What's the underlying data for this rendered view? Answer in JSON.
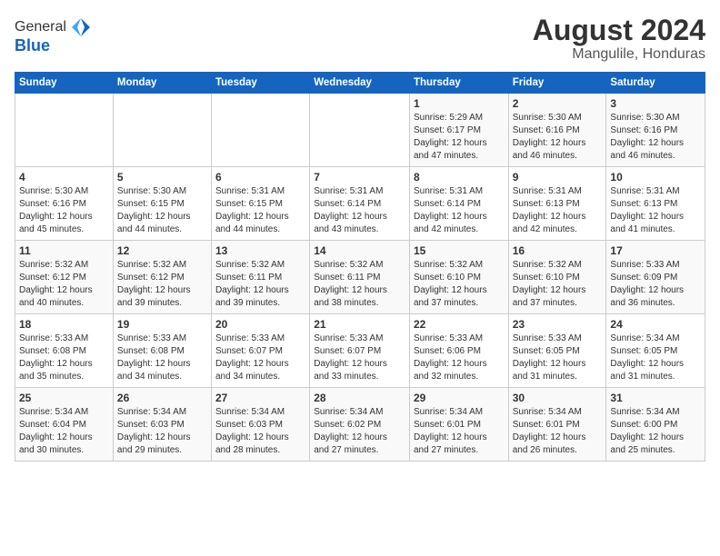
{
  "header": {
    "logo_general": "General",
    "logo_blue": "Blue",
    "title": "August 2024",
    "subtitle": "Mangulile, Honduras"
  },
  "calendar": {
    "days_of_week": [
      "Sunday",
      "Monday",
      "Tuesday",
      "Wednesday",
      "Thursday",
      "Friday",
      "Saturday"
    ],
    "weeks": [
      [
        {
          "day": "",
          "detail": ""
        },
        {
          "day": "",
          "detail": ""
        },
        {
          "day": "",
          "detail": ""
        },
        {
          "day": "",
          "detail": ""
        },
        {
          "day": "1",
          "detail": "Sunrise: 5:29 AM\nSunset: 6:17 PM\nDaylight: 12 hours\nand 47 minutes."
        },
        {
          "day": "2",
          "detail": "Sunrise: 5:30 AM\nSunset: 6:16 PM\nDaylight: 12 hours\nand 46 minutes."
        },
        {
          "day": "3",
          "detail": "Sunrise: 5:30 AM\nSunset: 6:16 PM\nDaylight: 12 hours\nand 46 minutes."
        }
      ],
      [
        {
          "day": "4",
          "detail": "Sunrise: 5:30 AM\nSunset: 6:16 PM\nDaylight: 12 hours\nand 45 minutes."
        },
        {
          "day": "5",
          "detail": "Sunrise: 5:30 AM\nSunset: 6:15 PM\nDaylight: 12 hours\nand 44 minutes."
        },
        {
          "day": "6",
          "detail": "Sunrise: 5:31 AM\nSunset: 6:15 PM\nDaylight: 12 hours\nand 44 minutes."
        },
        {
          "day": "7",
          "detail": "Sunrise: 5:31 AM\nSunset: 6:14 PM\nDaylight: 12 hours\nand 43 minutes."
        },
        {
          "day": "8",
          "detail": "Sunrise: 5:31 AM\nSunset: 6:14 PM\nDaylight: 12 hours\nand 42 minutes."
        },
        {
          "day": "9",
          "detail": "Sunrise: 5:31 AM\nSunset: 6:13 PM\nDaylight: 12 hours\nand 42 minutes."
        },
        {
          "day": "10",
          "detail": "Sunrise: 5:31 AM\nSunset: 6:13 PM\nDaylight: 12 hours\nand 41 minutes."
        }
      ],
      [
        {
          "day": "11",
          "detail": "Sunrise: 5:32 AM\nSunset: 6:12 PM\nDaylight: 12 hours\nand 40 minutes."
        },
        {
          "day": "12",
          "detail": "Sunrise: 5:32 AM\nSunset: 6:12 PM\nDaylight: 12 hours\nand 39 minutes."
        },
        {
          "day": "13",
          "detail": "Sunrise: 5:32 AM\nSunset: 6:11 PM\nDaylight: 12 hours\nand 39 minutes."
        },
        {
          "day": "14",
          "detail": "Sunrise: 5:32 AM\nSunset: 6:11 PM\nDaylight: 12 hours\nand 38 minutes."
        },
        {
          "day": "15",
          "detail": "Sunrise: 5:32 AM\nSunset: 6:10 PM\nDaylight: 12 hours\nand 37 minutes."
        },
        {
          "day": "16",
          "detail": "Sunrise: 5:32 AM\nSunset: 6:10 PM\nDaylight: 12 hours\nand 37 minutes."
        },
        {
          "day": "17",
          "detail": "Sunrise: 5:33 AM\nSunset: 6:09 PM\nDaylight: 12 hours\nand 36 minutes."
        }
      ],
      [
        {
          "day": "18",
          "detail": "Sunrise: 5:33 AM\nSunset: 6:08 PM\nDaylight: 12 hours\nand 35 minutes."
        },
        {
          "day": "19",
          "detail": "Sunrise: 5:33 AM\nSunset: 6:08 PM\nDaylight: 12 hours\nand 34 minutes."
        },
        {
          "day": "20",
          "detail": "Sunrise: 5:33 AM\nSunset: 6:07 PM\nDaylight: 12 hours\nand 34 minutes."
        },
        {
          "day": "21",
          "detail": "Sunrise: 5:33 AM\nSunset: 6:07 PM\nDaylight: 12 hours\nand 33 minutes."
        },
        {
          "day": "22",
          "detail": "Sunrise: 5:33 AM\nSunset: 6:06 PM\nDaylight: 12 hours\nand 32 minutes."
        },
        {
          "day": "23",
          "detail": "Sunrise: 5:33 AM\nSunset: 6:05 PM\nDaylight: 12 hours\nand 31 minutes."
        },
        {
          "day": "24",
          "detail": "Sunrise: 5:34 AM\nSunset: 6:05 PM\nDaylight: 12 hours\nand 31 minutes."
        }
      ],
      [
        {
          "day": "25",
          "detail": "Sunrise: 5:34 AM\nSunset: 6:04 PM\nDaylight: 12 hours\nand 30 minutes."
        },
        {
          "day": "26",
          "detail": "Sunrise: 5:34 AM\nSunset: 6:03 PM\nDaylight: 12 hours\nand 29 minutes."
        },
        {
          "day": "27",
          "detail": "Sunrise: 5:34 AM\nSunset: 6:03 PM\nDaylight: 12 hours\nand 28 minutes."
        },
        {
          "day": "28",
          "detail": "Sunrise: 5:34 AM\nSunset: 6:02 PM\nDaylight: 12 hours\nand 27 minutes."
        },
        {
          "day": "29",
          "detail": "Sunrise: 5:34 AM\nSunset: 6:01 PM\nDaylight: 12 hours\nand 27 minutes."
        },
        {
          "day": "30",
          "detail": "Sunrise: 5:34 AM\nSunset: 6:01 PM\nDaylight: 12 hours\nand 26 minutes."
        },
        {
          "day": "31",
          "detail": "Sunrise: 5:34 AM\nSunset: 6:00 PM\nDaylight: 12 hours\nand 25 minutes."
        }
      ]
    ]
  }
}
